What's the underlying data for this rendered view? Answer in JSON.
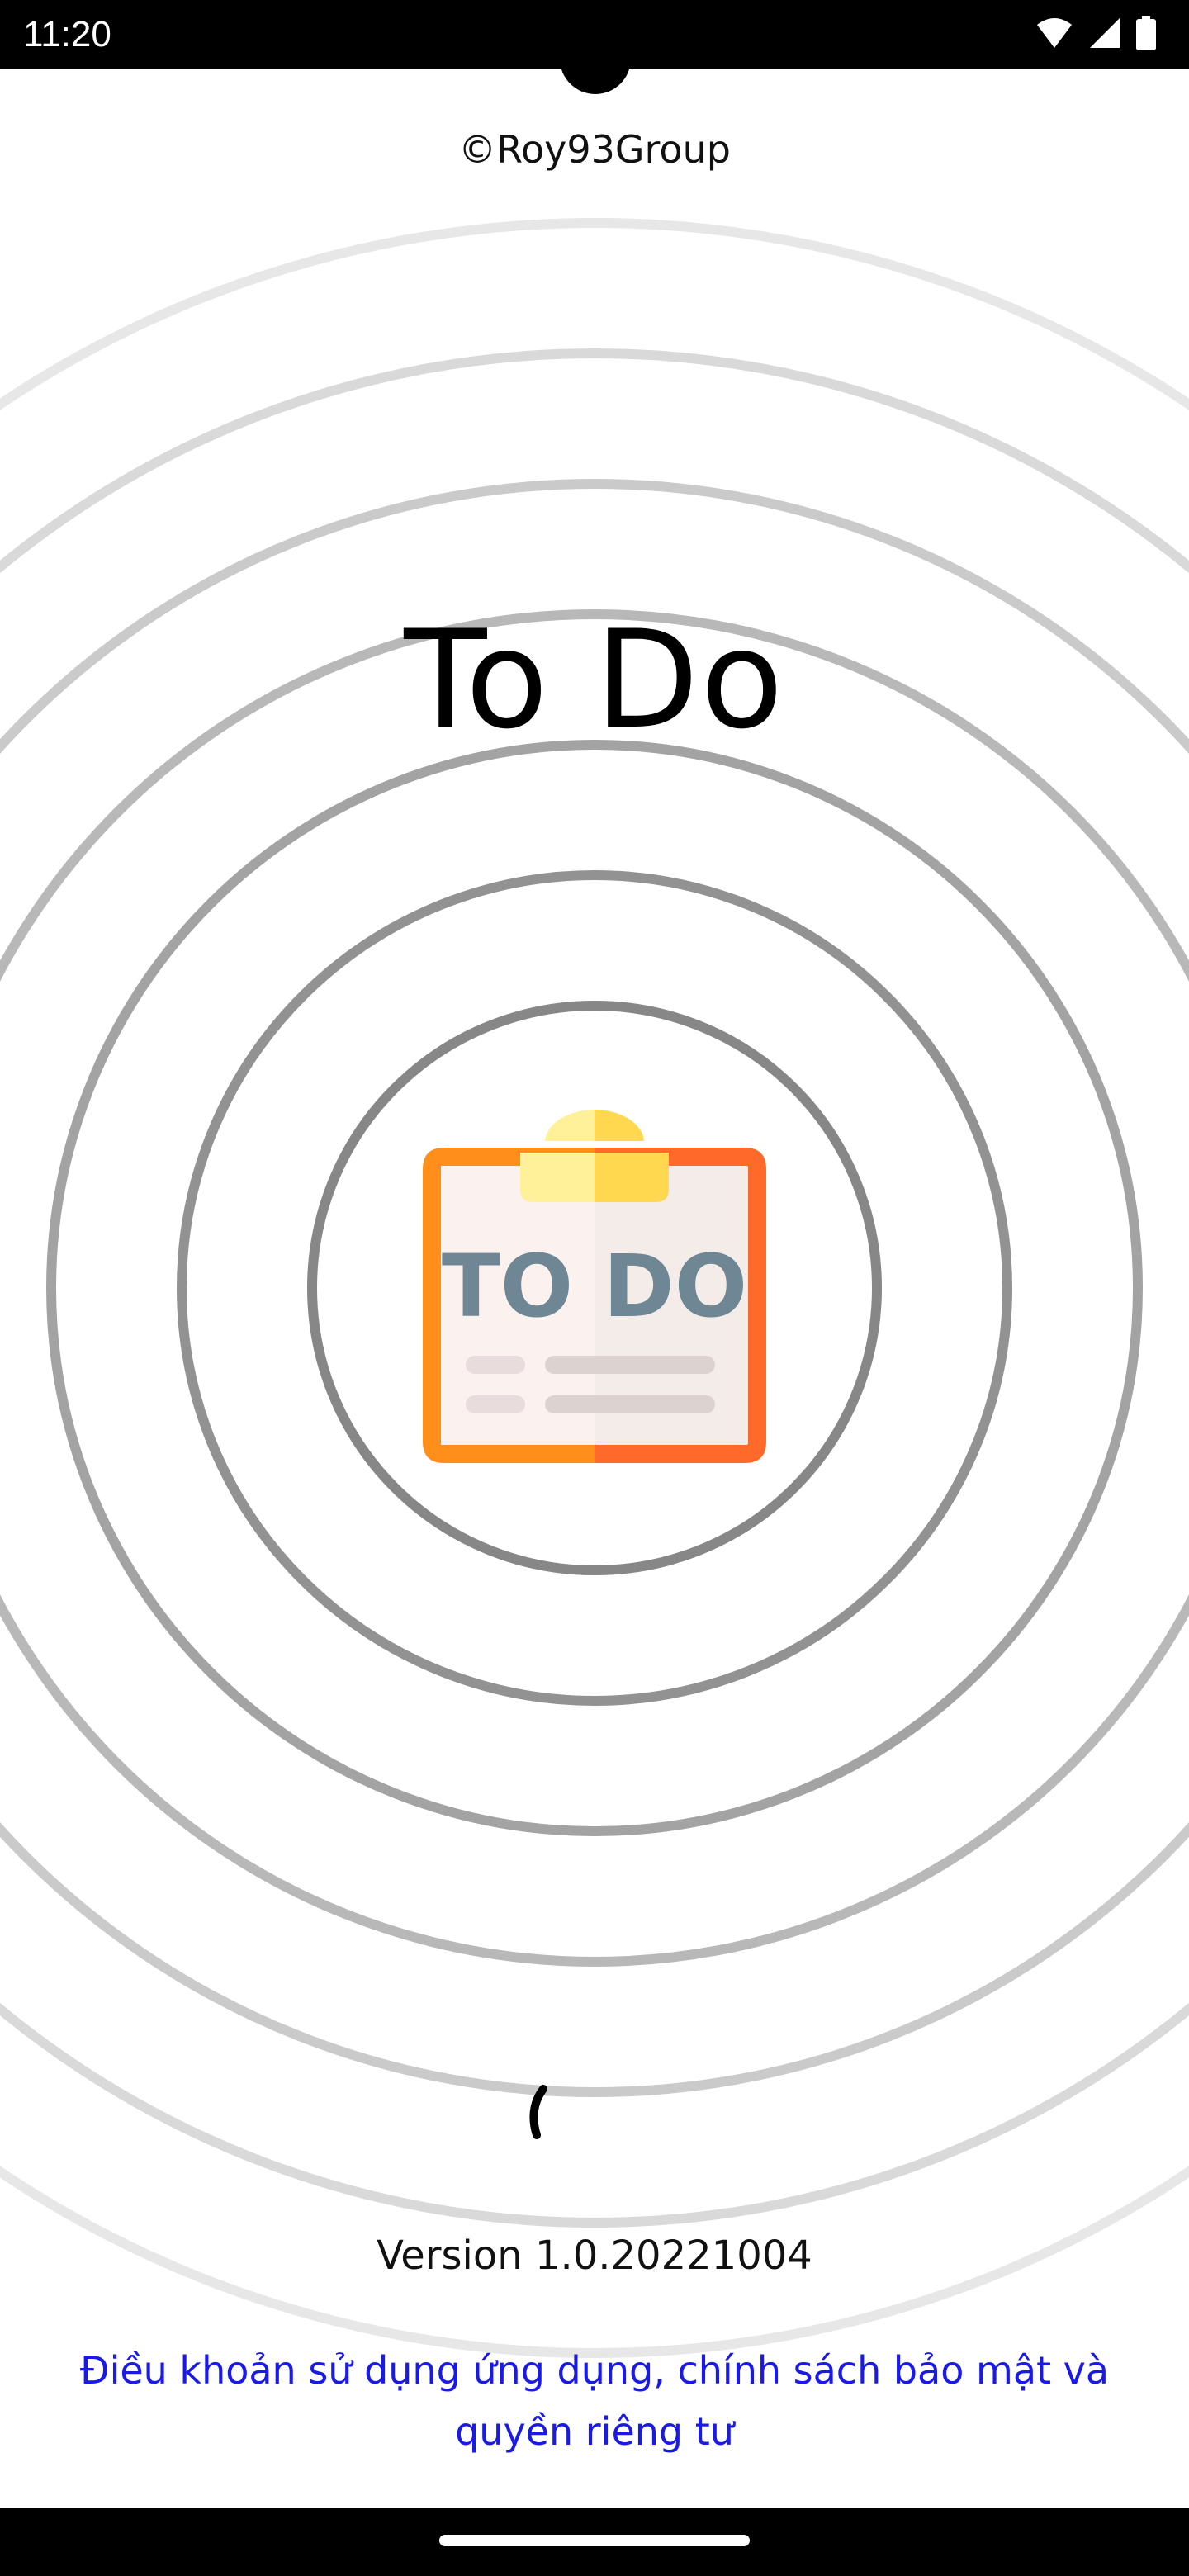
{
  "status_bar": {
    "time": "11:20",
    "icons": [
      "wifi-icon",
      "cellular-signal-icon",
      "battery-icon"
    ]
  },
  "screen": {
    "copyright": "©Roy93Group",
    "app_title": "To Do",
    "logo": {
      "icon": "todo-clipboard-icon",
      "text": "TO DO",
      "colors": {
        "frame_left": "#ff8f1a",
        "frame_right": "#ff6a2b",
        "clip_light": "#fff19a",
        "clip_dark": "#ffd84f",
        "text_light": "#78909c",
        "text_dark": "#546e7a",
        "paper_light": "#fbf1ef",
        "paper_dark": "#f3ece8"
      }
    },
    "loading_indicator": "spinner-icon",
    "version": "Version 1.0.20221004",
    "terms_link": "Điều khoản sử dụng ứng dụng, chính sách bảo mật và quyền riêng tư"
  },
  "colors": {
    "accent_link": "#1a1ae6",
    "ring": "#8a8a8a",
    "background": "#ffffff"
  }
}
